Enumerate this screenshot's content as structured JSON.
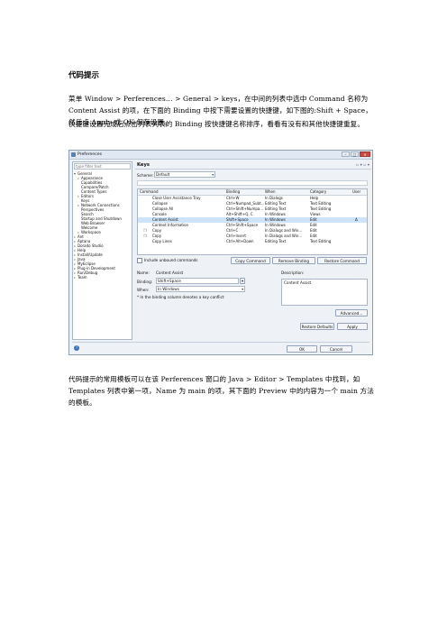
{
  "doc": {
    "title": "代码提示",
    "para1": "菜单 Window > Perferences… > General > keys，在中间的列表中选中 Command 名称为 Content Assist 的项，在下面的 Binding 中按下需要设置的快捷键，如下图的:Shift + Space，然后点 Apply 或 OK 保存设置。",
    "para2": "快捷键设置完成后点击列表列表的 Binding 按快捷键名称排序，看看有没有和其他快捷键重复。",
    "para3": "代码提示的常用模板可以在该 Perferences 窗口的 Java > Editor > Templates 中找到，如 Templates 列表中第一项，Name 为 main 的项，其下面的 Preview 中的内容为一个 main 方法的模板。"
  },
  "dialog": {
    "title": "Preferences",
    "filter_text": "type filter text",
    "tree": [
      "General",
      "Appearance",
      "Capabilities",
      "Compare/Patch",
      "Content Types",
      "Editors",
      "Keys",
      "Network Connections",
      "Perspectives",
      "Search",
      "Startup and Shutdown",
      "Web Browser",
      "Welcome",
      "Workspace",
      "Ant",
      "Aptana",
      "Dorado Studio",
      "Help",
      "Install/Update",
      "Java",
      "MyEclipse",
      "Plug-in Development",
      "Run/Debug",
      "Team"
    ],
    "page_title": "Keys",
    "nav_arrows": "⇦ ▾ ⇨ ▾",
    "scheme_label": "Scheme:",
    "scheme_value": "Default",
    "columns": [
      "Command",
      "Binding",
      "When",
      "Category",
      "User"
    ],
    "rows": [
      [
        "Close User Assistance Tray",
        "Ctrl+W",
        "In Dialogs",
        "Help",
        ""
      ],
      [
        "Collapse",
        "Ctrl+Numpad_Subt...",
        "Editing Text",
        "Text Editing",
        ""
      ],
      [
        "Collapse All",
        "Ctrl+Shift+Numpa...",
        "Editing Text",
        "Text Editing",
        ""
      ],
      [
        "Console",
        "Alt+Shift+Q, C",
        "In Windows",
        "Views",
        ""
      ],
      [
        "Content Assist",
        "Shift+Space",
        "In Windows",
        "Edit",
        "Δ"
      ],
      [
        "Context Information",
        "Ctrl+Shift+Space",
        "In Windows",
        "Edit",
        ""
      ],
      [
        "Copy",
        "Ctrl+C",
        "In Dialogs and Win...",
        "Edit",
        ""
      ],
      [
        "Copy",
        "Ctrl+Insert",
        "In Dialogs and Win...",
        "Edit",
        ""
      ],
      [
        "Copy Lines",
        "Ctrl+Alt+Down",
        "Editing Text",
        "Text Editing",
        ""
      ]
    ],
    "include_unbound": "Include unbound commands",
    "copy_command": "Copy Command",
    "remove_binding": "Remove Binding",
    "restore_command": "Restore Command",
    "name_label": "Name:",
    "name_value": "Content Assist",
    "binding_label": "Binding:",
    "binding_value": "Shift+Space",
    "when_label": "When:",
    "when_value": "In Windows",
    "description_label": "Description:",
    "description_value": "Content Assist",
    "conflict_note": "* In the binding column denotes a key conflict",
    "advanced": "Advanced...",
    "restore_defaults": "Restore Defaults",
    "apply": "Apply",
    "ok": "OK",
    "cancel": "Cancel",
    "help_glyph": "?"
  }
}
